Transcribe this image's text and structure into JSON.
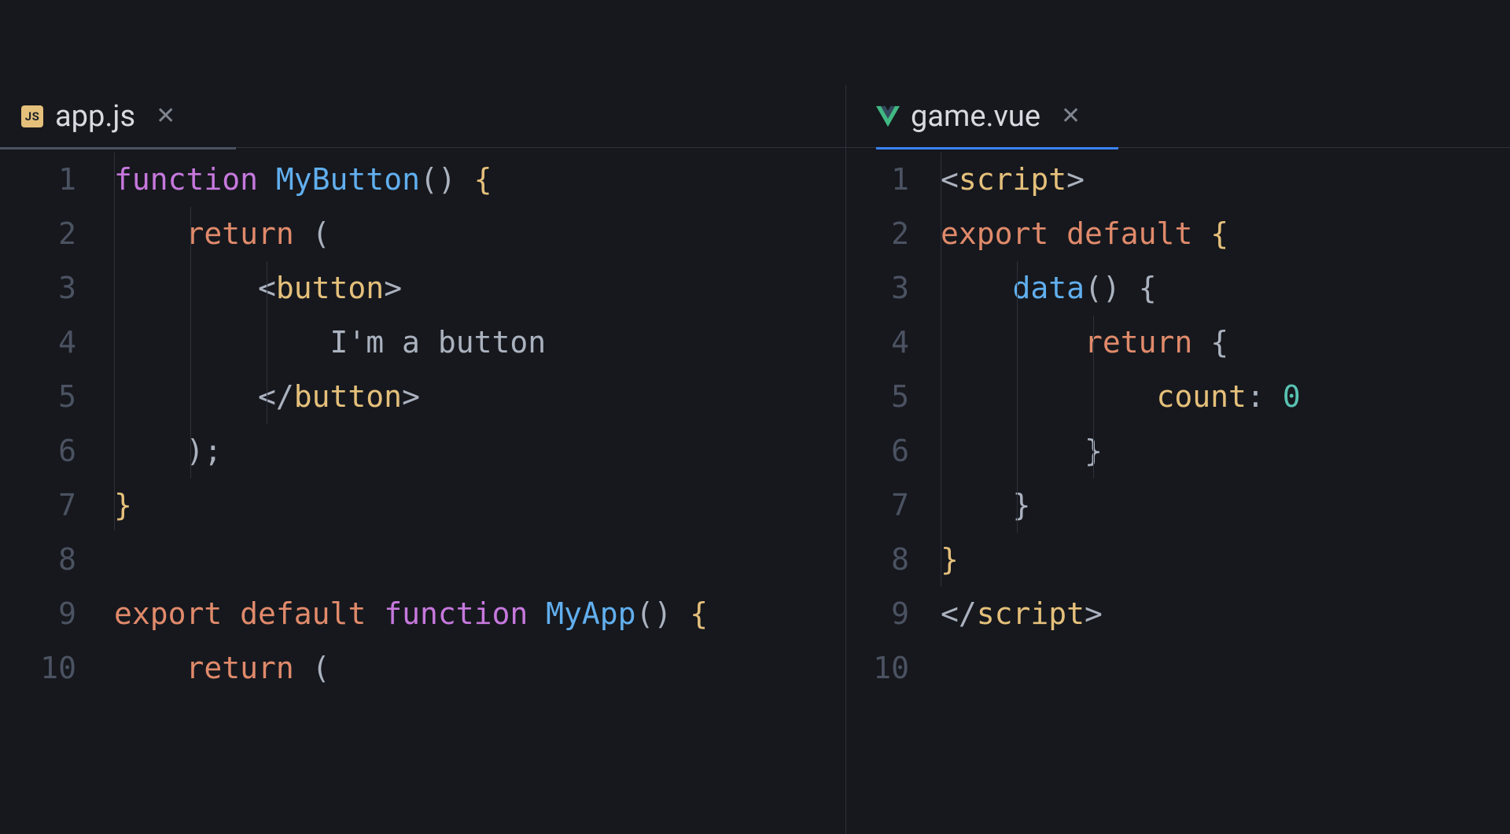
{
  "panes": {
    "left": {
      "tab": {
        "icon_text": "JS",
        "filename": "app.js"
      },
      "line_numbers": [
        "1",
        "2",
        "3",
        "4",
        "5",
        "6",
        "7",
        "8",
        "9",
        "10"
      ],
      "code": {
        "l1": {
          "kw": "function",
          "sp": " ",
          "fn": "MyButton",
          "par": "()",
          "sp2": " ",
          "ob": "{"
        },
        "l2": {
          "indent": "    ",
          "ret": "return",
          "sp": " ",
          "par": "("
        },
        "l3": {
          "indent": "        ",
          "lt": "<",
          "tag": "button",
          "gt": ">"
        },
        "l4": {
          "indent": "            ",
          "text": "I'm a button"
        },
        "l5": {
          "indent": "        ",
          "lt": "</",
          "tag": "button",
          "gt": ">"
        },
        "l6": {
          "indent": "    ",
          "par": ")",
          "semi": ";"
        },
        "l7": {
          "cb": "}"
        },
        "l8": {
          "blank": ""
        },
        "l9": {
          "exp": "export",
          "sp": " ",
          "def": "default",
          "sp2": " ",
          "kw": "function",
          "sp3": " ",
          "fn": "MyApp",
          "par": "()",
          "sp4": " ",
          "ob": "{"
        },
        "l10": {
          "indent": "    ",
          "ret": "return",
          "sp": " ",
          "par": "("
        }
      }
    },
    "right": {
      "tab": {
        "filename": "game.vue"
      },
      "line_numbers": [
        "1",
        "2",
        "3",
        "4",
        "5",
        "6",
        "7",
        "8",
        "9",
        "10"
      ],
      "code": {
        "l1": {
          "lt": "<",
          "tag": "script",
          "gt": ">"
        },
        "l2": {
          "exp": "export",
          "sp": " ",
          "def": "default",
          "sp2": " ",
          "ob": "{"
        },
        "l3": {
          "indent": "    ",
          "fn": "data",
          "par": "()",
          "sp": " ",
          "ob": "{"
        },
        "l4": {
          "indent": "        ",
          "ret": "return",
          "sp": " ",
          "ob": "{"
        },
        "l5": {
          "indent": "            ",
          "prop": "count",
          "col": ":",
          "sp": " ",
          "num": "0"
        },
        "l6": {
          "indent": "        ",
          "cb": "}"
        },
        "l7": {
          "indent": "    ",
          "cb": "}"
        },
        "l8": {
          "cb": "}"
        },
        "l9": {
          "lt": "</",
          "tag": "script",
          "gt": ">"
        },
        "l10": {
          "blank": ""
        }
      }
    }
  }
}
